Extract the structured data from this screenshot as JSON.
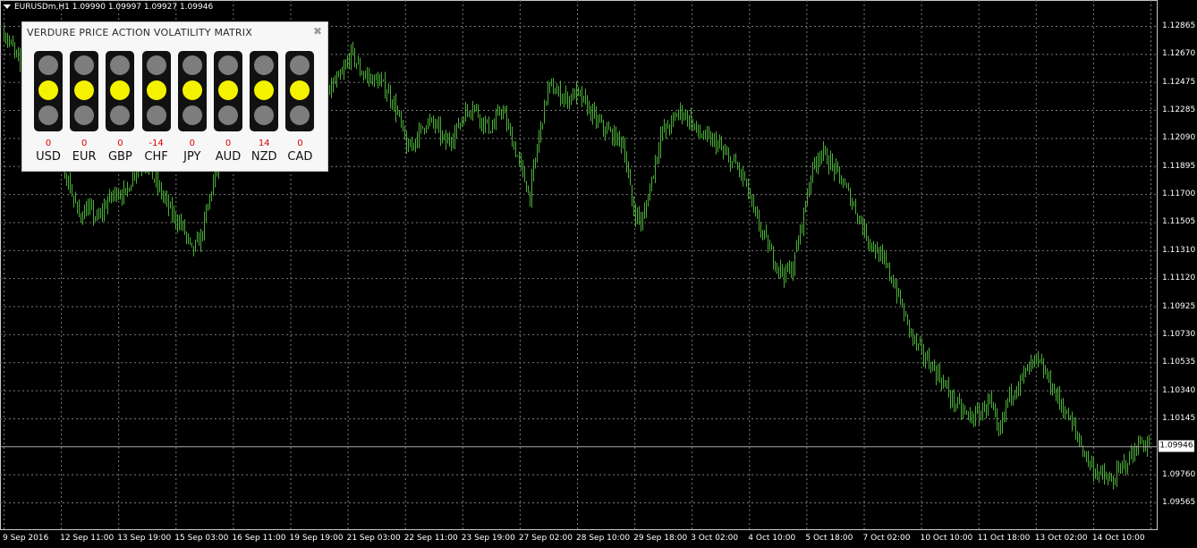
{
  "window": {
    "header": "EURUSDm,H1  1.09990 1.09997 1.09927 1.09946"
  },
  "chart_data": {
    "type": "bar",
    "symbol": "EURUSDm",
    "timeframe": "H1",
    "ohlc_last": {
      "open": 1.0999,
      "high": 1.09997,
      "low": 1.09927,
      "close": 1.09946
    },
    "current_price": "1.09946",
    "ylim": [
      1.09565,
      1.12915
    ],
    "y_ticks": [
      "1.12865",
      "1.12670",
      "1.12475",
      "1.12285",
      "1.12090",
      "1.11895",
      "1.11700",
      "1.11505",
      "1.11310",
      "1.11120",
      "1.10925",
      "1.10730",
      "1.10535",
      "1.10340",
      "1.10145",
      "1.09946",
      "1.09760",
      "1.09565"
    ],
    "x_ticks": [
      "9 Sep 2016",
      "12 Sep 11:00",
      "13 Sep 19:00",
      "15 Sep 03:00",
      "16 Sep 11:00",
      "19 Sep 19:00",
      "21 Sep 03:00",
      "22 Sep 11:00",
      "23 Sep 19:00",
      "27 Sep 02:00",
      "28 Sep 10:00",
      "29 Sep 18:00",
      "3 Oct 02:00",
      "4 Oct 10:00",
      "5 Oct 18:00",
      "7 Oct 02:00",
      "10 Oct 10:00",
      "11 Oct 18:00",
      "13 Oct 02:00",
      "14 Oct 10:00"
    ],
    "close_path": [
      [
        0,
        1.1282
      ],
      [
        1,
        1.127
      ],
      [
        2,
        1.1255
      ],
      [
        3,
        1.1238
      ],
      [
        4,
        1.1222
      ],
      [
        5,
        1.1208
      ],
      [
        6,
        1.1195
      ],
      [
        7,
        1.1175
      ],
      [
        8,
        1.1155
      ],
      [
        9,
        1.116
      ],
      [
        10,
        1.1152
      ],
      [
        11,
        1.1165
      ],
      [
        12,
        1.1172
      ],
      [
        13,
        1.117
      ],
      [
        14,
        1.1188
      ],
      [
        15,
        1.1192
      ],
      [
        16,
        1.118
      ],
      [
        17,
        1.1168
      ],
      [
        18,
        1.1155
      ],
      [
        19,
        1.1148
      ],
      [
        20,
        1.113
      ],
      [
        21,
        1.114
      ],
      [
        22,
        1.117
      ],
      [
        23,
        1.1195
      ],
      [
        24,
        1.12
      ],
      [
        25,
        1.1235
      ],
      [
        26,
        1.125
      ],
      [
        27,
        1.1228
      ],
      [
        28,
        1.1208
      ],
      [
        29,
        1.12
      ],
      [
        30,
        1.1198
      ],
      [
        31,
        1.1205
      ],
      [
        32,
        1.1225
      ],
      [
        33,
        1.124
      ],
      [
        34,
        1.1232
      ],
      [
        35,
        1.1245
      ],
      [
        36,
        1.1252
      ],
      [
        37,
        1.1268
      ],
      [
        38,
        1.1255
      ],
      [
        39,
        1.125
      ],
      [
        40,
        1.1248
      ],
      [
        41,
        1.124
      ],
      [
        42,
        1.1225
      ],
      [
        43,
        1.12
      ],
      [
        44,
        1.121
      ],
      [
        45,
        1.122
      ],
      [
        46,
        1.1218
      ],
      [
        47,
        1.1205
      ],
      [
        48,
        1.1212
      ],
      [
        49,
        1.1225
      ],
      [
        50,
        1.1232
      ],
      [
        51,
        1.122
      ],
      [
        52,
        1.1215
      ],
      [
        53,
        1.123
      ],
      [
        54,
        1.121
      ],
      [
        55,
        1.119
      ],
      [
        56,
        1.1168
      ],
      [
        57,
        1.121
      ],
      [
        58,
        1.1245
      ],
      [
        59,
        1.124
      ],
      [
        60,
        1.1236
      ],
      [
        61,
        1.124
      ],
      [
        62,
        1.1232
      ],
      [
        63,
        1.1222
      ],
      [
        64,
        1.1215
      ],
      [
        65,
        1.121
      ],
      [
        66,
        1.1205
      ],
      [
        67,
        1.116
      ],
      [
        68,
        1.115
      ],
      [
        69,
        1.118
      ],
      [
        70,
        1.1212
      ],
      [
        71,
        1.1218
      ],
      [
        72,
        1.1228
      ],
      [
        73,
        1.1222
      ],
      [
        74,
        1.1212
      ],
      [
        75,
        1.1208
      ],
      [
        76,
        1.1205
      ],
      [
        77,
        1.1195
      ],
      [
        78,
        1.119
      ],
      [
        79,
        1.1178
      ],
      [
        80,
        1.1155
      ],
      [
        81,
        1.114
      ],
      [
        82,
        1.1125
      ],
      [
        83,
        1.1115
      ],
      [
        84,
        1.1118
      ],
      [
        85,
        1.115
      ],
      [
        86,
        1.1185
      ],
      [
        87,
        1.12
      ],
      [
        88,
        1.1192
      ],
      [
        89,
        1.1182
      ],
      [
        90,
        1.117
      ],
      [
        91,
        1.1155
      ],
      [
        92,
        1.114
      ],
      [
        93,
        1.113
      ],
      [
        94,
        1.112
      ],
      [
        95,
        1.1105
      ],
      [
        96,
        1.1085
      ],
      [
        97,
        1.1068
      ],
      [
        98,
        1.1058
      ],
      [
        99,
        1.105
      ],
      [
        100,
        1.104
      ],
      [
        101,
        1.1028
      ],
      [
        102,
        1.102
      ],
      [
        103,
        1.1015
      ],
      [
        104,
        1.1018
      ],
      [
        105,
        1.1028
      ],
      [
        106,
        1.1002
      ],
      [
        107,
        1.103
      ],
      [
        108,
        1.1038
      ],
      [
        109,
        1.1048
      ],
      [
        110,
        1.1055
      ],
      [
        111,
        1.1045
      ],
      [
        112,
        1.1032
      ],
      [
        113,
        1.102
      ],
      [
        114,
        1.1008
      ],
      [
        115,
        1.0992
      ],
      [
        116,
        1.098
      ],
      [
        117,
        1.0975
      ],
      [
        118,
        1.097
      ],
      [
        119,
        1.098
      ],
      [
        120,
        1.0988
      ],
      [
        121,
        1.0998
      ],
      [
        122,
        1.0996
      ]
    ],
    "grid": true,
    "series_color": "#4caf38"
  },
  "matrix": {
    "title": "VERDURE PRICE ACTION VOLATILITY MATRIX",
    "close_glyph": "✖",
    "currencies": [
      {
        "name": "USD",
        "value": "0",
        "state": "middle"
      },
      {
        "name": "EUR",
        "value": "0",
        "state": "middle"
      },
      {
        "name": "GBP",
        "value": "0",
        "state": "middle"
      },
      {
        "name": "CHF",
        "value": "-14",
        "state": "middle"
      },
      {
        "name": "JPY",
        "value": "0",
        "state": "middle"
      },
      {
        "name": "AUD",
        "value": "0",
        "state": "middle"
      },
      {
        "name": "NZD",
        "value": "14",
        "state": "middle"
      },
      {
        "name": "CAD",
        "value": "0",
        "state": "middle"
      }
    ],
    "colors": {
      "lamp_on": "#f5f200",
      "lamp_off": "#7d7d7d",
      "value_text": "#e00000"
    }
  }
}
